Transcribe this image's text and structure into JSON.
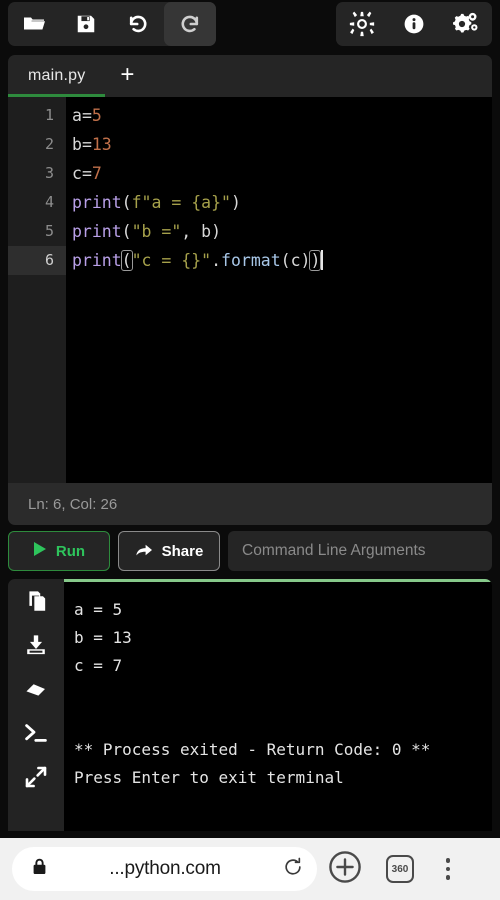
{
  "toolbar": {
    "left_buttons": [
      {
        "name": "open-file-button",
        "icon": "folder-open-icon",
        "active": false
      },
      {
        "name": "save-file-button",
        "icon": "save-floppy-icon",
        "active": false
      },
      {
        "name": "undo-button",
        "icon": "undo-icon",
        "active": false
      },
      {
        "name": "redo-button",
        "icon": "redo-icon",
        "active": true
      }
    ],
    "right_buttons": [
      {
        "name": "theme-brightness-button",
        "icon": "sun-brightness-icon"
      },
      {
        "name": "info-button",
        "icon": "info-circle-icon"
      },
      {
        "name": "settings-button",
        "icon": "gears-settings-icon"
      }
    ]
  },
  "tabs": {
    "items": [
      {
        "label": "main.py",
        "active": true
      }
    ],
    "add_label": "+",
    "active_indicator_color": "#2e8b3d"
  },
  "editor": {
    "line_numbers": [
      "1",
      "2",
      "3",
      "4",
      "5",
      "6"
    ],
    "active_line": 6,
    "lines": [
      {
        "n": 1,
        "text": "a=5"
      },
      {
        "n": 2,
        "text": "b=13"
      },
      {
        "n": 3,
        "text": "c=7"
      },
      {
        "n": 4,
        "text": "print(f\"a = {a}\")"
      },
      {
        "n": 5,
        "text": "print(\"b =\", b)"
      },
      {
        "n": 6,
        "text": "print(\"c = {}\".format(c))"
      }
    ],
    "full_text": "a=5\nb=13\nc=7\nprint(f\"a = {a}\")\nprint(\"b =\", b)\nprint(\"c = {}\".format(c))",
    "tokens": {
      "l1": {
        "var": "a",
        "op": "=",
        "num": "5"
      },
      "l2": {
        "var": "b",
        "op": "=",
        "num": "13"
      },
      "l3": {
        "var": "c",
        "op": "=",
        "num": "7"
      },
      "l4": {
        "fn": "print",
        "open": "(",
        "str": "f\"a = {a}\"",
        "close": ")"
      },
      "l5": {
        "fn": "print",
        "open": "(",
        "str": "\"b =\"",
        "sep": ", ",
        "var": "b",
        "close": ")"
      },
      "l6": {
        "fn": "print",
        "open": "(",
        "str": "\"c = {}\"",
        "dot": ".",
        "meth": "format",
        "open2": "(",
        "var": "c",
        "close2": ")",
        "close": ")"
      }
    },
    "colors": {
      "background": "#000000",
      "gutter": "#1e1e1e",
      "number": "#c0704a",
      "function": "#b9a0e8",
      "string": "#a6a14b",
      "method": "#a8c7e8",
      "variable": "#d8d8d8"
    }
  },
  "status": {
    "text": "Ln: 6,  Col: 26",
    "line": 6,
    "column": 26
  },
  "actions": {
    "run_label": "Run",
    "share_label": "Share",
    "cmdargs_placeholder": "Command Line Arguments",
    "cmdargs_value": "",
    "run_color": "#2ec45c"
  },
  "console": {
    "side_buttons": [
      {
        "name": "copy-output-button",
        "icon": "copy-icon"
      },
      {
        "name": "download-output-button",
        "icon": "download-icon"
      },
      {
        "name": "clear-output-button",
        "icon": "eraser-icon"
      },
      {
        "name": "terminal-button",
        "icon": "terminal-prompt-icon"
      },
      {
        "name": "expand-console-button",
        "icon": "expand-arrows-icon"
      }
    ],
    "top_border_color": "#86c98a",
    "output_lines": [
      "a = 5",
      "b = 13",
      "c = 7",
      "",
      "",
      "** Process exited - Return Code: 0 **",
      "Press Enter to exit terminal"
    ]
  },
  "browser": {
    "url_text": "...python.com",
    "lock_icon": "lock-icon",
    "reload_icon": "reload-icon",
    "new_tab_icon": "plus-circle-icon",
    "tab_count": "360",
    "menu_icon": "three-dots-vertical-icon"
  }
}
